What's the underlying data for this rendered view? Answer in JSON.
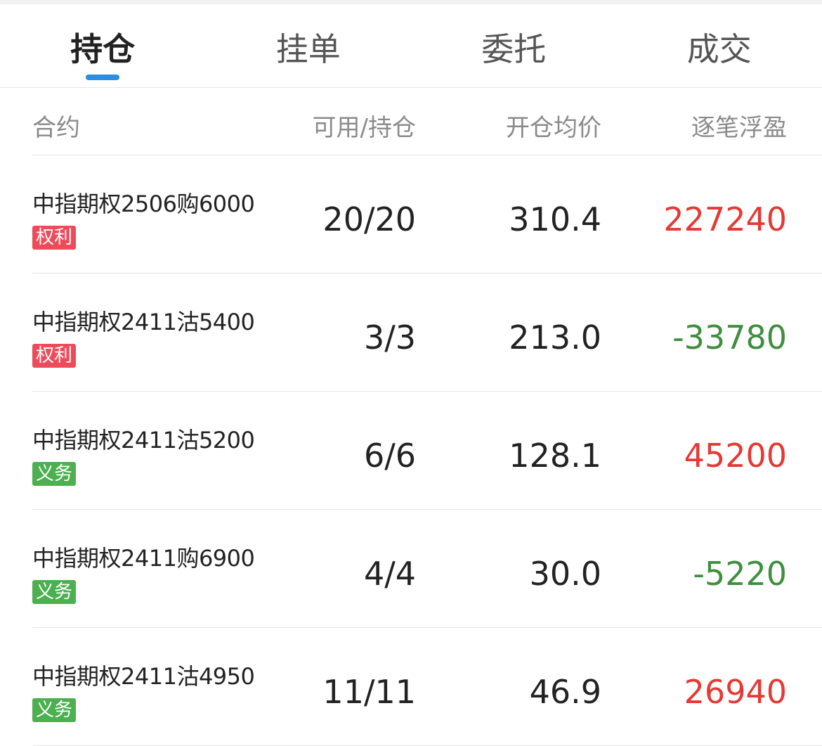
{
  "tabs": [
    {
      "label": "持仓",
      "active": true
    },
    {
      "label": "挂单",
      "active": false
    },
    {
      "label": "委托",
      "active": false
    },
    {
      "label": "成交",
      "active": false
    }
  ],
  "columns": {
    "contract": "合约",
    "available_position": "可用/持仓",
    "open_avg_price": "开仓均价",
    "floating_pnl": "逐笔浮盈"
  },
  "rows": [
    {
      "contract": "中指期权2506购6000",
      "tag": "权利",
      "tag_color": "#ee4b5a",
      "available_position": "20/20",
      "open_avg_price": "310.4",
      "floating_pnl": "227240",
      "pnl_color": "#e53935"
    },
    {
      "contract": "中指期权2411沽5400",
      "tag": "权利",
      "tag_color": "#ee4b5a",
      "available_position": "3/3",
      "open_avg_price": "213.0",
      "floating_pnl": "-33780",
      "pnl_color": "#3e8f3e"
    },
    {
      "contract": "中指期权2411沽5200",
      "tag": "义务",
      "tag_color": "#4caf50",
      "available_position": "6/6",
      "open_avg_price": "128.1",
      "floating_pnl": "45200",
      "pnl_color": "#e53935"
    },
    {
      "contract": "中指期权2411购6900",
      "tag": "义务",
      "tag_color": "#4caf50",
      "available_position": "4/4",
      "open_avg_price": "30.0",
      "floating_pnl": "-5220",
      "pnl_color": "#3e8f3e"
    },
    {
      "contract": "中指期权2411沽4950",
      "tag": "义务",
      "tag_color": "#4caf50",
      "available_position": "11/11",
      "open_avg_price": "46.9",
      "floating_pnl": "26940",
      "pnl_color": "#e53935"
    }
  ],
  "colors": {
    "accent": "#2a8fe0",
    "profit": "#e53935",
    "loss": "#3e8f3e"
  }
}
